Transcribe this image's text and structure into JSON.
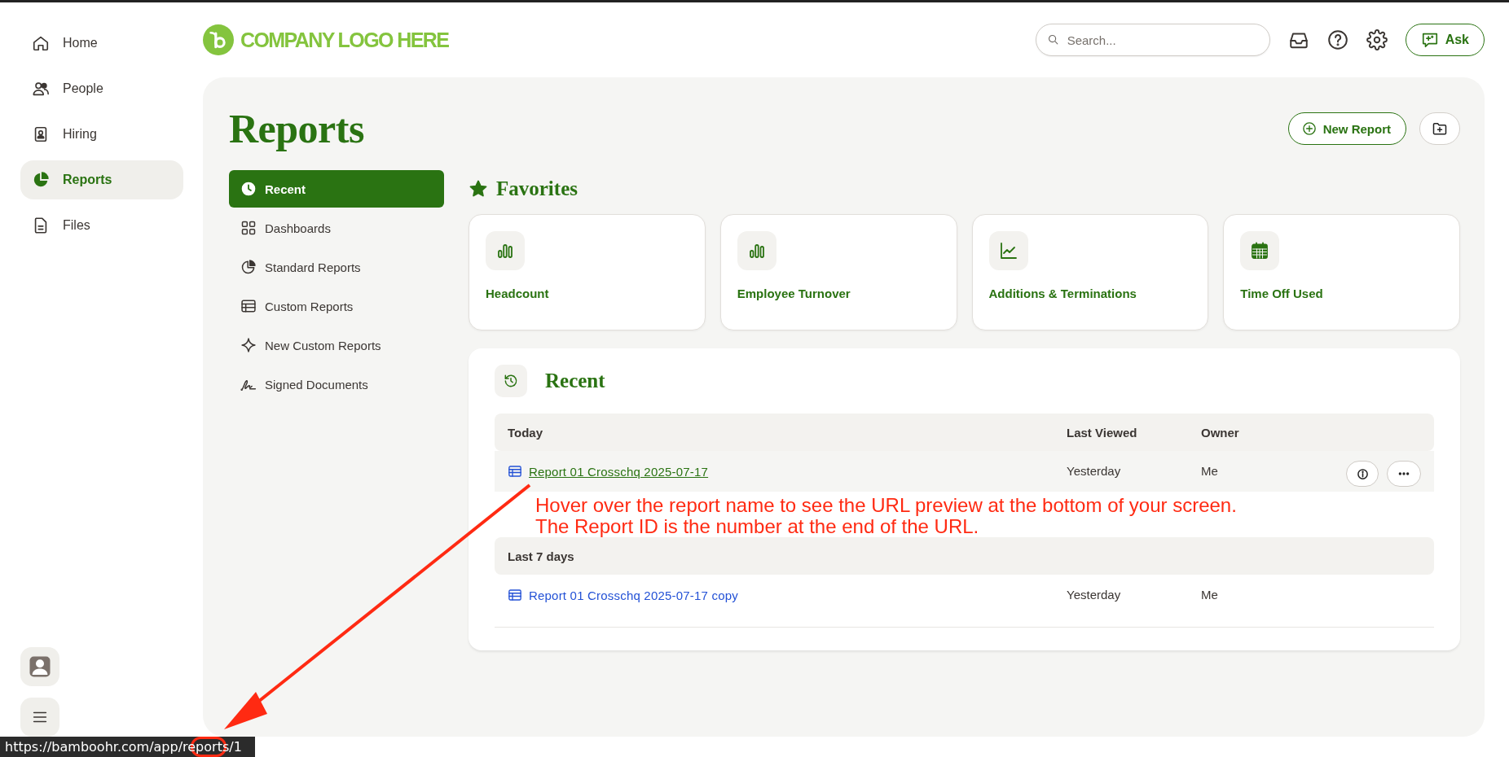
{
  "sidebar": {
    "items": [
      {
        "label": "Home",
        "selected": false
      },
      {
        "label": "People",
        "selected": false
      },
      {
        "label": "Hiring",
        "selected": false
      },
      {
        "label": "Reports",
        "selected": true
      },
      {
        "label": "Files",
        "selected": false
      }
    ]
  },
  "header": {
    "logo_text": "COMPANY LOGO HERE",
    "search": {
      "placeholder": "Search..."
    },
    "ask_button": "Ask"
  },
  "page": {
    "title": "Reports",
    "new_report_button": "New Report"
  },
  "report_nav": {
    "items": [
      {
        "label": "Recent",
        "selected": true
      },
      {
        "label": "Dashboards",
        "selected": false
      },
      {
        "label": "Standard Reports",
        "selected": false
      },
      {
        "label": "Custom Reports",
        "selected": false
      },
      {
        "label": "New Custom Reports",
        "selected": false
      },
      {
        "label": "Signed Documents",
        "selected": false
      }
    ]
  },
  "favorites": {
    "title": "Favorites",
    "cards": [
      {
        "label": "Headcount"
      },
      {
        "label": "Employee Turnover"
      },
      {
        "label": "Additions & Terminations"
      },
      {
        "label": "Time Off Used"
      }
    ]
  },
  "recent": {
    "title": "Recent",
    "groups": [
      {
        "label": "Today",
        "columns": [
          "Last Viewed",
          "Owner"
        ],
        "rows": [
          {
            "name": "Report 01 Crosschq 2025-07-17",
            "last_viewed": "Yesterday",
            "owner": "Me",
            "hovered": true
          }
        ]
      },
      {
        "label": "Last 7 days",
        "rows": [
          {
            "name": "Report 01 Crosschq 2025-07-17 copy",
            "last_viewed": "Yesterday",
            "owner": "Me",
            "hovered": false
          }
        ]
      }
    ]
  },
  "annotation": {
    "lines": [
      "Hover over the report name to see the URL preview at the bottom of your screen.",
      "The Report ID is the number at the end of the URL."
    ]
  },
  "status_bar": {
    "url": "https://bamboohr.com/app/reports/1"
  }
}
